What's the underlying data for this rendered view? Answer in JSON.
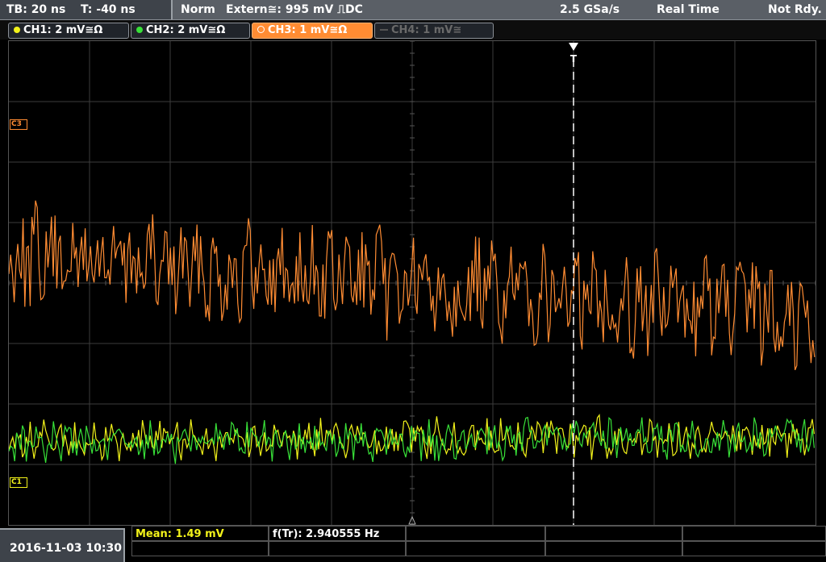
{
  "header": {
    "timebase": "TB: 20 ns",
    "trigger_offset": "T: -40 ns",
    "mode": "Norm",
    "trigger_source": "Extern≅: 995 mV ⎍DC",
    "sample_rate": "2.5 GSa/s",
    "acq_mode": "Real Time",
    "status": "Not Rdy."
  },
  "channels": [
    {
      "label": "CH1: 2 mV≅Ω",
      "color": "#f2f21a",
      "active": true
    },
    {
      "label": "CH2: 2 mV≅Ω",
      "color": "#38e038",
      "active": true
    },
    {
      "label": "CH3: 1 mV≅Ω",
      "color": "#ff8c33",
      "active": true,
      "selected": true
    },
    {
      "label": "CH4: 1 mV≅",
      "color": "#6a6a6a",
      "active": false
    }
  ],
  "markers": {
    "c3": "C3",
    "c1": "C1",
    "trigger": "T"
  },
  "colors": {
    "ch1": "#f2f21a",
    "ch2": "#38e038",
    "ch3": "#ff8c33",
    "grid": "#3c3c3c"
  },
  "footer": {
    "datetime": "2016-11-03 10:30",
    "mean": "Mean: 1.49 mV",
    "freq": "f(Tr): 2.940555 Hz"
  }
}
